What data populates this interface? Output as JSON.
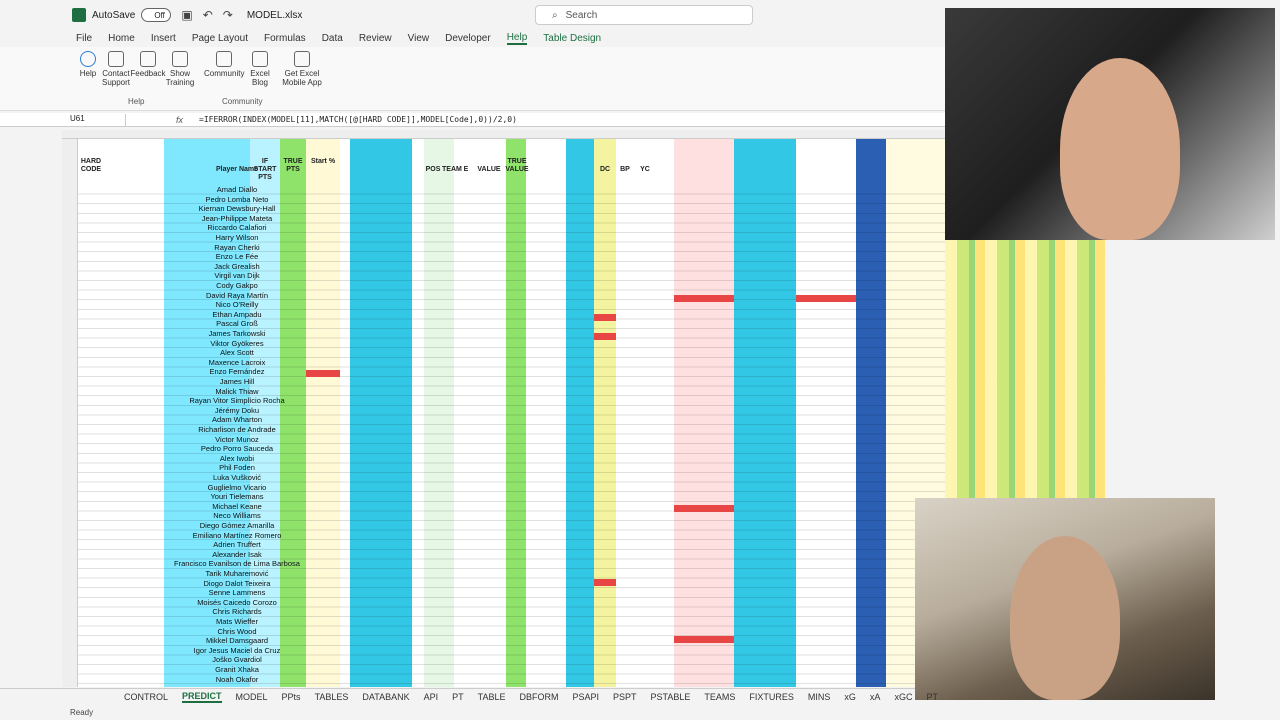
{
  "titlebar": {
    "autosave": "AutoSave",
    "toggle": "Off",
    "filename": "MODEL.xlsx"
  },
  "search": {
    "placeholder": "Search"
  },
  "menu": [
    {
      "label": "File"
    },
    {
      "label": "Home"
    },
    {
      "label": "Insert"
    },
    {
      "label": "Page Layout"
    },
    {
      "label": "Formulas"
    },
    {
      "label": "Data"
    },
    {
      "label": "Review"
    },
    {
      "label": "View"
    },
    {
      "label": "Developer"
    },
    {
      "label": "Help"
    },
    {
      "label": "Table Design"
    }
  ],
  "ribbon": {
    "help": "Help",
    "contact": "Contact Support",
    "feedback": "Feedback",
    "training": "Show Training",
    "community": "Community",
    "blog": "Excel Blog",
    "mobile": "Get Excel Mobile App",
    "group_help": "Help",
    "group_community": "Community"
  },
  "formula_bar": {
    "cell": "U61",
    "formula": "=IFERROR(INDEX(MODEL[11],MATCH([@[HARD CODE]],MODEL[Code],0))/2,0)"
  },
  "headers": {
    "hard_code": "HARD CODE",
    "player_name": "Player Name",
    "if_start": "IF START PTS",
    "true_pts": "TRUE PTS",
    "start_pct": "Start %",
    "pos": "POS",
    "team": "TEAM",
    "e": "E",
    "value": "VALUE",
    "true_value": "TRUE VALUE",
    "dc": "DC",
    "bp": "BP",
    "yc": "YC"
  },
  "players": [
    "Amad Diallo",
    "Pedro Lomba Neto",
    "Kiernan Dewsbury-Hall",
    "Jean-Philippe Mateta",
    "Riccardo Calafiori",
    "Harry Wilson",
    "Rayan Cherki",
    "Enzo Le Fée",
    "Jack Grealish",
    "Virgil van Dijk",
    "Cody Gakpo",
    "David Raya Martín",
    "Nico O'Reilly",
    "Ethan Ampadu",
    "Pascal Groß",
    "James Tarkowski",
    "Viktor Gyökeres",
    "Alex Scott",
    "Maxence Lacroix",
    "Enzo Fernández",
    "James Hill",
    "Malick Thiaw",
    "Rayan Vitor Simplício Rocha",
    "Jérémy Doku",
    "Adam Wharton",
    "Richarlison de Andrade",
    "Victor Munoz",
    "Pedro Porro Sauceda",
    "Alex Iwobi",
    "Phil Foden",
    "Luka Vušković",
    "Guglielmo Vicario",
    "Youri Tielemans",
    "Michael Keane",
    "Neco Williams",
    "Diego Gómez Amarilla",
    "Emiliano Martínez Romero",
    "Adrien Truffert",
    "Alexander Isak",
    "Francisco Evanilson de Lima Barbosa",
    "Tarik Muharemović",
    "Diogo Dalot Teixeira",
    "Senne Lammens",
    "Moisés Caicedo Corozo",
    "Chris Richards",
    "Mats Wieffer",
    "Chris Wood",
    "Mikkel Damsgaard",
    "Igor Jesus Maciel da Cruz",
    "Joško Gvardiol",
    "Granit Xhaka",
    "Noah Okafor"
  ],
  "sheet_tabs": [
    {
      "label": "CONTROL"
    },
    {
      "label": "PREDICT"
    },
    {
      "label": "MODEL"
    },
    {
      "label": "PPts"
    },
    {
      "label": "TABLES"
    },
    {
      "label": "DATABANK"
    },
    {
      "label": "API"
    },
    {
      "label": "PT"
    },
    {
      "label": "TABLE"
    },
    {
      "label": "DBFORM"
    },
    {
      "label": "PSAPI"
    },
    {
      "label": "PSPT"
    },
    {
      "label": "PSTABLE"
    },
    {
      "label": "TEAMS"
    },
    {
      "label": "FIXTURES"
    },
    {
      "label": "MINS"
    },
    {
      "label": "xG"
    },
    {
      "label": "xA"
    },
    {
      "label": "xGC"
    },
    {
      "label": "PT"
    }
  ],
  "status": {
    "ready": "Ready"
  },
  "colors": {
    "accent": "#1d6f42",
    "cyan": "#33c7e6",
    "green": "#8fe36b",
    "red": "#e84545",
    "yellow": "#fff36b"
  }
}
